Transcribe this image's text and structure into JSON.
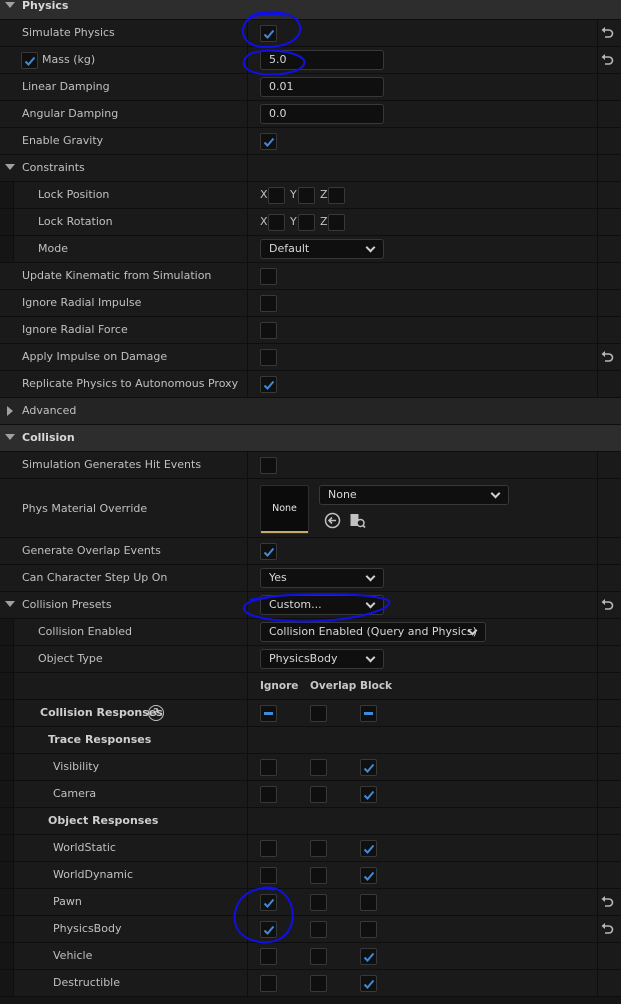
{
  "colors": {
    "accent": "#3d8bd9",
    "annotation": "#1010e6"
  },
  "physics": {
    "title": "Physics",
    "simulate_physics": "Simulate Physics",
    "mass_label": "Mass (kg)",
    "mass_value": "5.0",
    "linear_damping": "Linear Damping",
    "linear_damping_value": "0.01",
    "angular_damping": "Angular Damping",
    "angular_damping_value": "0.0",
    "enable_gravity": "Enable Gravity",
    "constraints": "Constraints",
    "lock_position": "Lock Position",
    "lock_rotation": "Lock Rotation",
    "axis_x": "X",
    "axis_y": "Y",
    "axis_z": "Z",
    "mode": "Mode",
    "mode_value": "Default",
    "update_kinematic": "Update Kinematic from Simulation",
    "ignore_radial_impulse": "Ignore Radial Impulse",
    "ignore_radial_force": "Ignore Radial Force",
    "apply_impulse": "Apply Impulse on Damage",
    "replicate_physics": "Replicate Physics to Autonomous Proxy",
    "advanced": "Advanced"
  },
  "collision": {
    "title": "Collision",
    "sim_hit_events": "Simulation Generates Hit Events",
    "phys_material": "Phys Material Override",
    "phys_material_thumb": "None",
    "phys_material_value": "None",
    "gen_overlap": "Generate Overlap Events",
    "can_step": "Can Character Step Up On",
    "can_step_value": "Yes",
    "presets": "Collision Presets",
    "presets_value": "Custom...",
    "enabled": "Collision Enabled",
    "enabled_value": "Collision Enabled (Query and Physics)",
    "object_type": "Object Type",
    "object_type_value": "PhysicsBody",
    "col_ignore": "Ignore",
    "col_overlap": "Overlap",
    "col_block": "Block",
    "responses": "Collision Responses",
    "help_glyph": "?",
    "trace_responses": "Trace Responses",
    "object_responses": "Object Responses",
    "channels": [
      {
        "label": "Visibility",
        "response": "Block"
      },
      {
        "label": "Camera",
        "response": "Block"
      },
      {
        "label": "WorldStatic",
        "response": "Block"
      },
      {
        "label": "WorldDynamic",
        "response": "Block"
      },
      {
        "label": "Pawn",
        "response": "Ignore"
      },
      {
        "label": "PhysicsBody",
        "response": "Ignore"
      },
      {
        "label": "Vehicle",
        "response": "Block"
      },
      {
        "label": "Destructible",
        "response": "Block"
      }
    ]
  },
  "icons": {
    "reset": "reset-arrow-icon",
    "browse": "browse-asset-icon",
    "use_selected": "use-selected-icon",
    "help": "help-icon"
  }
}
